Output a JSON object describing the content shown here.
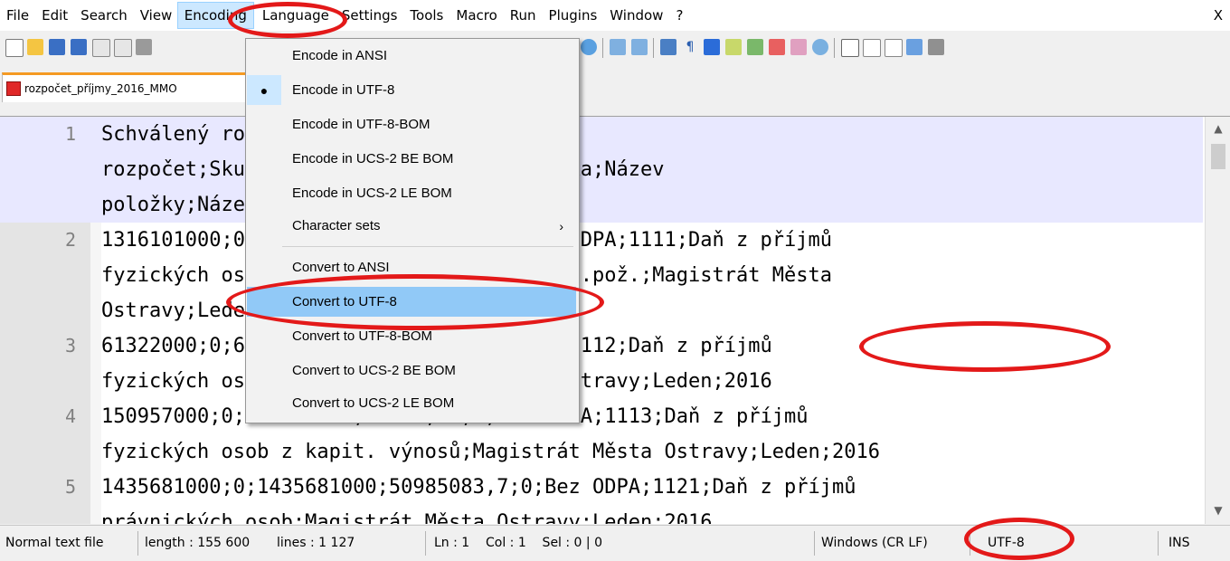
{
  "menubar": {
    "items": [
      "File",
      "Edit",
      "Search",
      "View",
      "Encoding",
      "Language",
      "Settings",
      "Tools",
      "Macro",
      "Run",
      "Plugins",
      "Window",
      "?"
    ],
    "active": "Encoding",
    "close_label": "X"
  },
  "toolbar": {
    "icons": [
      "new-file-icon",
      "open-file-icon",
      "save-icon",
      "save-all-icon",
      "close-icon",
      "close-all-icon",
      "print-icon",
      "find-icon",
      "sync-vertical-icon",
      "sync-horizontal-icon",
      "word-wrap-icon",
      "show-all-characters-icon",
      "indent-guide-icon",
      "document-map-icon",
      "folder-workspace-icon",
      "function-list-icon",
      "folder-icon",
      "monitoring-icon",
      "record-macro-icon",
      "stop-recording-icon",
      "play-macro-icon",
      "run-macro-multiple-icon",
      "save-macro-icon"
    ]
  },
  "tab": {
    "label": "rozpočet_příjmy_2016_MMO",
    "icon": "save-state-icon"
  },
  "editor": {
    "lines": [
      {
        "number": "1",
        "segments": [
          "Schválený rozpočet;Upravený",
          "rozpočet;Skutečnost;Kód odpa;Odpa;Položka;Název",
          "položky;Název organizace;Období;Rok"
        ]
      },
      {
        "number": "2",
        "segments": [
          "1316101000;0;1316101000;102356,4;0;Bez ODPA;1111;Daň z příjmů",
          "fyzických osob ze závislé činnosti a fun.pož.;Magistrát Města",
          "Ostravy;Leden;2016"
        ]
      },
      {
        "number": "3",
        "segments": [
          "61322000;0;61322000;30574,4;0;Bez ODPA;1112;Daň z příjmů",
          "fyzických osob ze SVČ;Magistrát Města Ostravy;Leden;2016"
        ]
      },
      {
        "number": "4",
        "segments": [
          "150957000;0;150957000;14725,73;0;Bez ODPA;1113;Daň z příjmů",
          "fyzických osob z kapit. výnosů;Magistrát Města Ostravy;Leden;2016"
        ]
      },
      {
        "number": "5",
        "segments": [
          "1435681000;0;1435681000;50985083,7;0;Bez ODPA;1121;Daň z příjmů",
          "právnických osob;Magistrát Města Ostravy;Leden;2016"
        ]
      }
    ]
  },
  "encoding_menu": {
    "items": [
      {
        "label": "Encode in ANSI"
      },
      {
        "label": "Encode in UTF-8",
        "checked": true
      },
      {
        "label": "Encode in UTF-8-BOM"
      },
      {
        "label": "Encode in UCS-2 BE BOM"
      },
      {
        "label": "Encode in UCS-2 LE BOM"
      },
      {
        "label": "Character sets",
        "submenu": true
      },
      {
        "label": "Convert to ANSI"
      },
      {
        "label": "Convert to UTF-8",
        "highlighted": true
      },
      {
        "label": "Convert to UTF-8-BOM"
      },
      {
        "label": "Convert to UCS-2 BE BOM"
      },
      {
        "label": "Convert to UCS-2 LE BOM"
      }
    ],
    "check_mark": "●",
    "submenu_arrow": "›"
  },
  "statusbar": {
    "doc_type": "Normal text file",
    "length": "length : 155 600",
    "lines": "lines : 1 127",
    "position": "Ln : 1    Col : 1    Sel : 0 | 0",
    "eol": "Windows (CR LF)",
    "encoding": "UTF-8",
    "mode": "INS"
  },
  "annotations": {
    "color": "#e31919"
  }
}
